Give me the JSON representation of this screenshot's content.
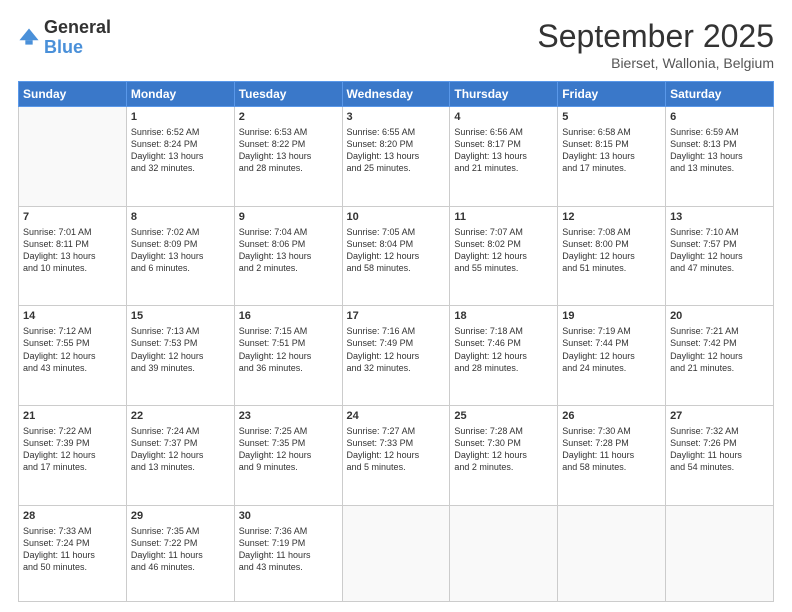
{
  "header": {
    "logo_general": "General",
    "logo_blue": "Blue",
    "month": "September 2025",
    "location": "Bierset, Wallonia, Belgium"
  },
  "days_of_week": [
    "Sunday",
    "Monday",
    "Tuesday",
    "Wednesday",
    "Thursday",
    "Friday",
    "Saturday"
  ],
  "weeks": [
    [
      {
        "day": "",
        "info": ""
      },
      {
        "day": "1",
        "info": "Sunrise: 6:52 AM\nSunset: 8:24 PM\nDaylight: 13 hours\nand 32 minutes."
      },
      {
        "day": "2",
        "info": "Sunrise: 6:53 AM\nSunset: 8:22 PM\nDaylight: 13 hours\nand 28 minutes."
      },
      {
        "day": "3",
        "info": "Sunrise: 6:55 AM\nSunset: 8:20 PM\nDaylight: 13 hours\nand 25 minutes."
      },
      {
        "day": "4",
        "info": "Sunrise: 6:56 AM\nSunset: 8:17 PM\nDaylight: 13 hours\nand 21 minutes."
      },
      {
        "day": "5",
        "info": "Sunrise: 6:58 AM\nSunset: 8:15 PM\nDaylight: 13 hours\nand 17 minutes."
      },
      {
        "day": "6",
        "info": "Sunrise: 6:59 AM\nSunset: 8:13 PM\nDaylight: 13 hours\nand 13 minutes."
      }
    ],
    [
      {
        "day": "7",
        "info": "Sunrise: 7:01 AM\nSunset: 8:11 PM\nDaylight: 13 hours\nand 10 minutes."
      },
      {
        "day": "8",
        "info": "Sunrise: 7:02 AM\nSunset: 8:09 PM\nDaylight: 13 hours\nand 6 minutes."
      },
      {
        "day": "9",
        "info": "Sunrise: 7:04 AM\nSunset: 8:06 PM\nDaylight: 13 hours\nand 2 minutes."
      },
      {
        "day": "10",
        "info": "Sunrise: 7:05 AM\nSunset: 8:04 PM\nDaylight: 12 hours\nand 58 minutes."
      },
      {
        "day": "11",
        "info": "Sunrise: 7:07 AM\nSunset: 8:02 PM\nDaylight: 12 hours\nand 55 minutes."
      },
      {
        "day": "12",
        "info": "Sunrise: 7:08 AM\nSunset: 8:00 PM\nDaylight: 12 hours\nand 51 minutes."
      },
      {
        "day": "13",
        "info": "Sunrise: 7:10 AM\nSunset: 7:57 PM\nDaylight: 12 hours\nand 47 minutes."
      }
    ],
    [
      {
        "day": "14",
        "info": "Sunrise: 7:12 AM\nSunset: 7:55 PM\nDaylight: 12 hours\nand 43 minutes."
      },
      {
        "day": "15",
        "info": "Sunrise: 7:13 AM\nSunset: 7:53 PM\nDaylight: 12 hours\nand 39 minutes."
      },
      {
        "day": "16",
        "info": "Sunrise: 7:15 AM\nSunset: 7:51 PM\nDaylight: 12 hours\nand 36 minutes."
      },
      {
        "day": "17",
        "info": "Sunrise: 7:16 AM\nSunset: 7:49 PM\nDaylight: 12 hours\nand 32 minutes."
      },
      {
        "day": "18",
        "info": "Sunrise: 7:18 AM\nSunset: 7:46 PM\nDaylight: 12 hours\nand 28 minutes."
      },
      {
        "day": "19",
        "info": "Sunrise: 7:19 AM\nSunset: 7:44 PM\nDaylight: 12 hours\nand 24 minutes."
      },
      {
        "day": "20",
        "info": "Sunrise: 7:21 AM\nSunset: 7:42 PM\nDaylight: 12 hours\nand 21 minutes."
      }
    ],
    [
      {
        "day": "21",
        "info": "Sunrise: 7:22 AM\nSunset: 7:39 PM\nDaylight: 12 hours\nand 17 minutes."
      },
      {
        "day": "22",
        "info": "Sunrise: 7:24 AM\nSunset: 7:37 PM\nDaylight: 12 hours\nand 13 minutes."
      },
      {
        "day": "23",
        "info": "Sunrise: 7:25 AM\nSunset: 7:35 PM\nDaylight: 12 hours\nand 9 minutes."
      },
      {
        "day": "24",
        "info": "Sunrise: 7:27 AM\nSunset: 7:33 PM\nDaylight: 12 hours\nand 5 minutes."
      },
      {
        "day": "25",
        "info": "Sunrise: 7:28 AM\nSunset: 7:30 PM\nDaylight: 12 hours\nand 2 minutes."
      },
      {
        "day": "26",
        "info": "Sunrise: 7:30 AM\nSunset: 7:28 PM\nDaylight: 11 hours\nand 58 minutes."
      },
      {
        "day": "27",
        "info": "Sunrise: 7:32 AM\nSunset: 7:26 PM\nDaylight: 11 hours\nand 54 minutes."
      }
    ],
    [
      {
        "day": "28",
        "info": "Sunrise: 7:33 AM\nSunset: 7:24 PM\nDaylight: 11 hours\nand 50 minutes."
      },
      {
        "day": "29",
        "info": "Sunrise: 7:35 AM\nSunset: 7:22 PM\nDaylight: 11 hours\nand 46 minutes."
      },
      {
        "day": "30",
        "info": "Sunrise: 7:36 AM\nSunset: 7:19 PM\nDaylight: 11 hours\nand 43 minutes."
      },
      {
        "day": "",
        "info": ""
      },
      {
        "day": "",
        "info": ""
      },
      {
        "day": "",
        "info": ""
      },
      {
        "day": "",
        "info": ""
      }
    ]
  ]
}
